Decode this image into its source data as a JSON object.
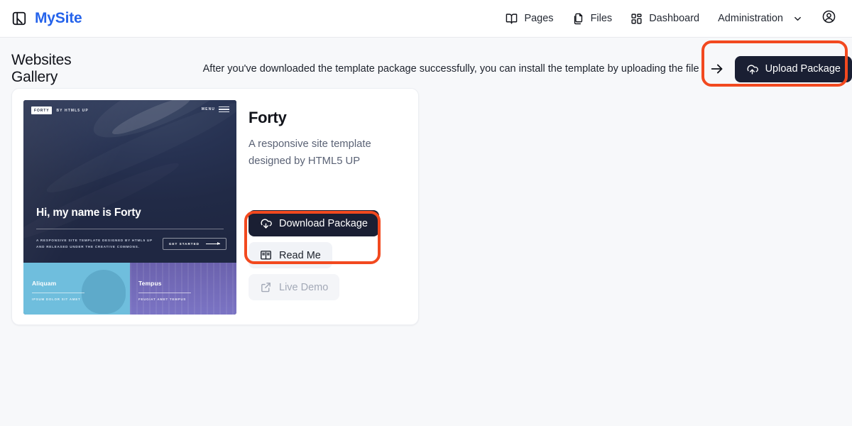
{
  "brand": {
    "name": "MySite",
    "logo_icon": "app-window-icon",
    "color": "#2563eb"
  },
  "nav": {
    "items": [
      {
        "label": "Pages",
        "icon": "book-open-icon"
      },
      {
        "label": "Files",
        "icon": "copy-files-icon"
      },
      {
        "label": "Dashboard",
        "icon": "layout-dashboard-icon"
      },
      {
        "label": "Administration",
        "icon": "chevron-down-icon"
      }
    ],
    "account_icon": "user-circle-icon"
  },
  "header": {
    "title": "Websites Gallery",
    "hint": "After you've downloaded the template package successfully, you can install the template by uploading the file",
    "arrow_icon": "arrow-right-icon",
    "upload_button": {
      "label": "Upload Package",
      "icon": "cloud-upload-icon"
    }
  },
  "card": {
    "template": {
      "name": "Forty",
      "description": "A responsive site template designed by HTML5 UP"
    },
    "actions": [
      {
        "label": "Download Package",
        "icon": "cloud-download-icon",
        "style": "dark",
        "disabled": false
      },
      {
        "label": "Read Me",
        "icon": "book-icon",
        "style": "soft",
        "disabled": false
      },
      {
        "label": "Live Demo",
        "icon": "external-link-icon",
        "style": "soft",
        "disabled": true
      }
    ],
    "thumbnail": {
      "logo": "FORTY",
      "logo_sub": "BY HTML5 UP",
      "menu_label": "MENU",
      "hero_title": "Hi, my name is Forty",
      "hero_desc_line1": "A RESPONSIVE SITE TEMPLATE DESIGNED BY HTML5 UP",
      "hero_desc_line2": "AND RELEASED UNDER THE CREATIVE COMMONS.",
      "cta_label": "GET STARTED",
      "tiles": [
        {
          "title": "Aliquam",
          "subtitle": "IPSUM DOLOR SIT AMET",
          "color": "#6fbedd"
        },
        {
          "title": "Tempus",
          "subtitle": "FEUGIAT AMET TEMPUS",
          "color": "#7b74c4"
        }
      ]
    }
  },
  "annotations": {
    "highlight_color": "#f2491f",
    "boxes": [
      "upload-package-highlight",
      "download-package-highlight"
    ]
  }
}
